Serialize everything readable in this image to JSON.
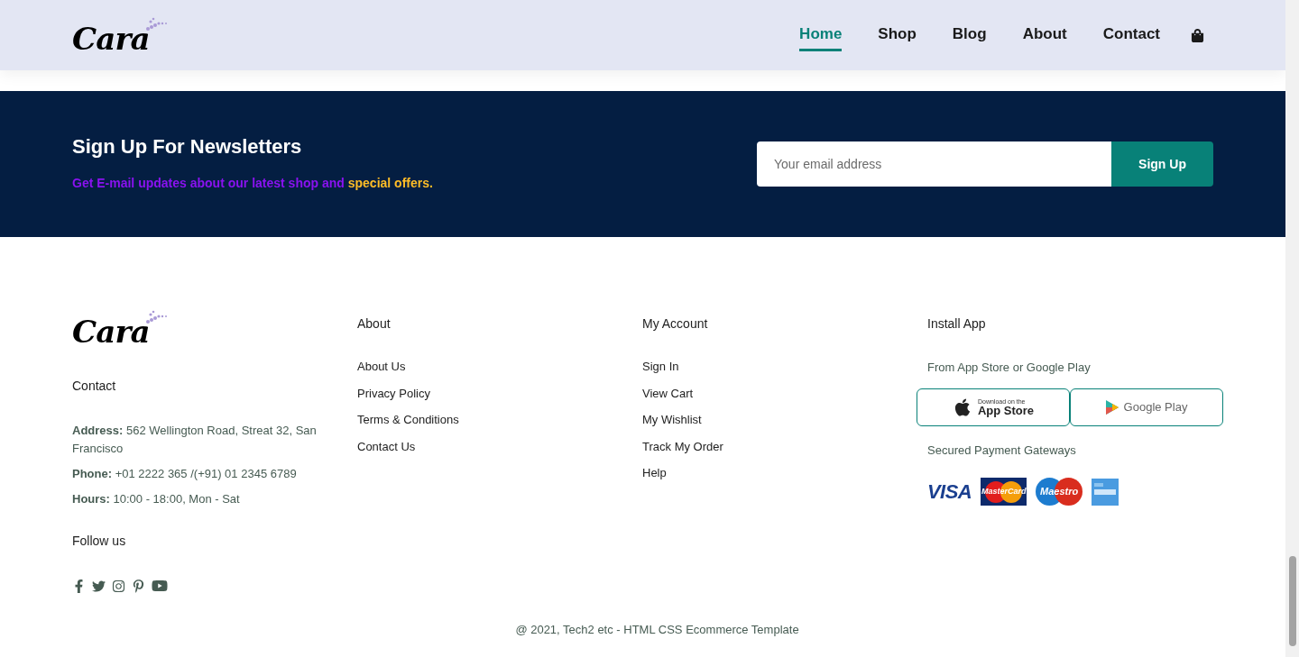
{
  "header": {
    "logo": "Cara",
    "nav": [
      {
        "label": "Home",
        "selected": true
      },
      {
        "label": "Shop",
        "selected": false
      },
      {
        "label": "Blog",
        "selected": false
      },
      {
        "label": "About",
        "selected": false
      },
      {
        "label": "Contact",
        "selected": false
      }
    ]
  },
  "newsletter": {
    "title": "Sign Up For Newsletters",
    "subtitle": "Get E-mail updates about our latest shop and",
    "highlight": "special offers.",
    "email": {
      "placeholder": "Your email address"
    },
    "button": "Sign Up"
  },
  "footer": {
    "logo": "Cara",
    "contact_heading": "Contact",
    "contact_lines": [
      {
        "label": "Address:",
        "value": "562 Wellington Road, Streat 32, San Francisco"
      },
      {
        "label": "Phone:",
        "value": "+01 2222 365 /(+91) 01 2345 6789"
      },
      {
        "label": "Hours:",
        "value": "10:00 - 18:00, Mon - Sat"
      }
    ],
    "follow_heading": "Follow us",
    "social": [
      {
        "kind": "facebook"
      },
      {
        "kind": "twitter"
      },
      {
        "kind": "instagram"
      },
      {
        "kind": "pinterest"
      },
      {
        "kind": "youtube"
      }
    ],
    "columns": [
      {
        "heading": "About",
        "links": [
          "About Us",
          "Privacy Policy",
          "Terms & Conditions",
          "Contact Us"
        ]
      },
      {
        "heading": "My Account",
        "links": [
          "Sign In",
          "View Cart",
          "My Wishlist",
          "Track My Order",
          "Help"
        ]
      }
    ],
    "install": {
      "heading": "Install App",
      "subtitle": "From App Store or Google Play",
      "app_store": {
        "small": "Download on the",
        "large": "App Store"
      },
      "google_play": "Google Play",
      "payments_heading": "Secured Payment Gateways",
      "payments": [
        {
          "kind": "visa",
          "label": "VISA"
        },
        {
          "kind": "mastercard",
          "label": "MasterCard"
        },
        {
          "kind": "maestro",
          "label": "Maestro"
        },
        {
          "kind": "amex"
        }
      ]
    },
    "copyright": "@ 2021, Tech2 etc - HTML CSS Ecommerce Template"
  }
}
